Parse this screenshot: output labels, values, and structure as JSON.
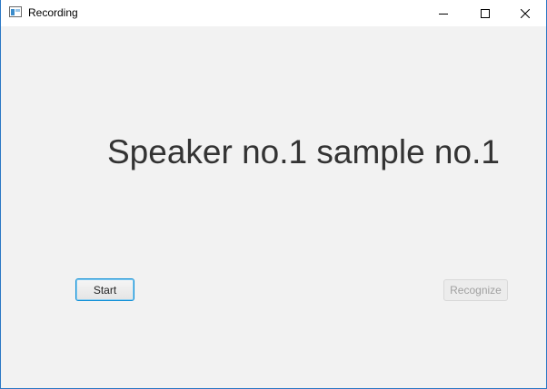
{
  "window": {
    "title": "Recording",
    "controls": {
      "minimize": "minimize-icon",
      "maximize": "maximize-icon",
      "close": "close-icon"
    }
  },
  "main": {
    "heading": "Speaker no.1 sample no.1",
    "start_label": "Start",
    "recognize_label": "Recognize",
    "recognize_disabled": true
  },
  "colors": {
    "background": "#f2f2f2",
    "heading_text": "#333333",
    "focus_border": "#0f8fd6",
    "window_border": "#2b78c5",
    "disabled_text": "#a0a0a0"
  }
}
